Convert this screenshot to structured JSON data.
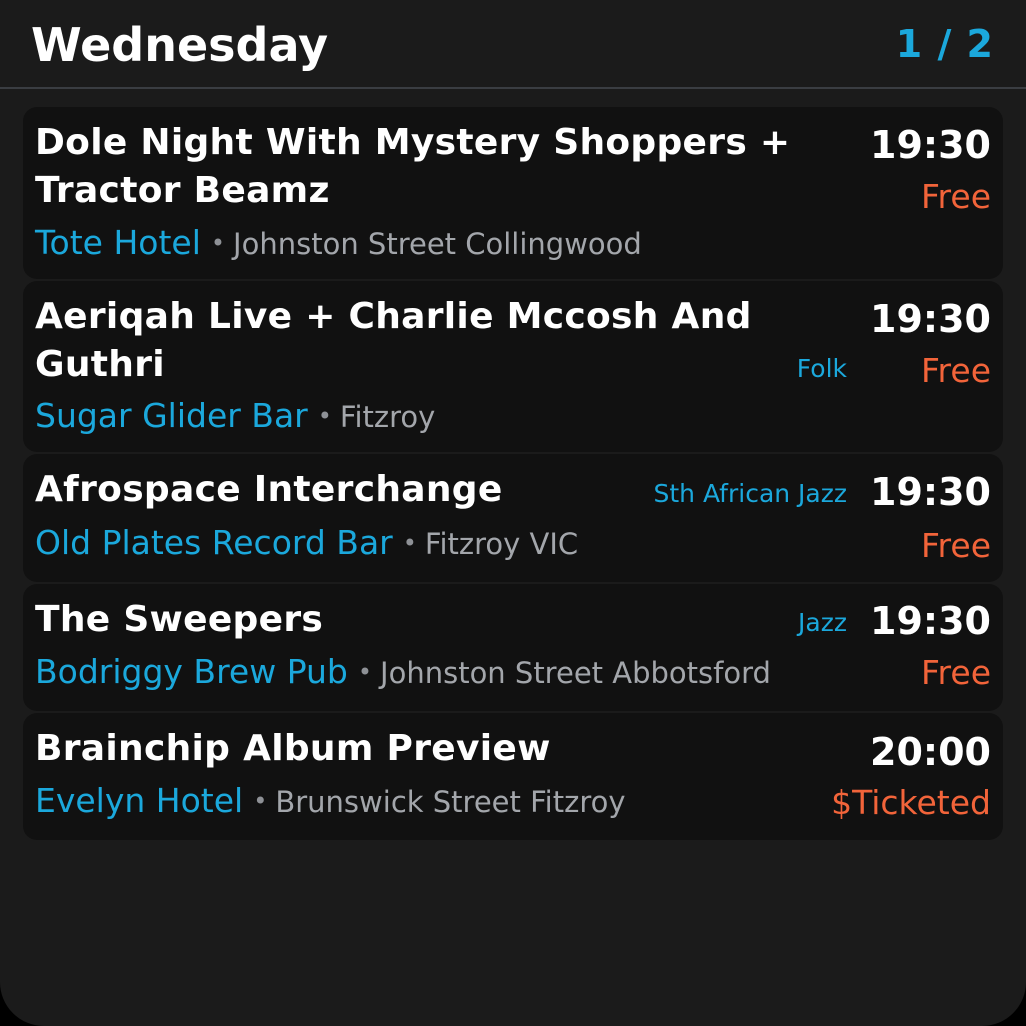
{
  "header": {
    "day": "Wednesday",
    "page_indicator": "1 / 2"
  },
  "colors": {
    "background": "#1b1b1b",
    "card": "#111111",
    "accent": "#1ba8dc",
    "price": "#f2643a",
    "title": "#ffffff",
    "muted": "#a3a6ab"
  },
  "separator": "•",
  "events": [
    {
      "title": "Dole Night With Mystery Shoppers + Tractor Beamz",
      "venue": "Tote Hotel",
      "location": "Johnston Street Collingwood",
      "genre": "",
      "time": "19:30",
      "price": "Free"
    },
    {
      "title": "Aeriqah Live + Charlie Mccosh And Guthri",
      "venue": "Sugar Glider Bar",
      "location": "Fitzroy",
      "genre": "Folk",
      "time": "19:30",
      "price": "Free"
    },
    {
      "title": "Afrospace Interchange",
      "venue": "Old Plates Record Bar",
      "location": "Fitzroy VIC",
      "genre": "Sth African Jazz",
      "time": "19:30",
      "price": "Free"
    },
    {
      "title": "The Sweepers",
      "venue": "Bodriggy Brew Pub",
      "location": "Johnston Street Abbotsford",
      "genre": "Jazz",
      "time": "19:30",
      "price": "Free"
    },
    {
      "title": "Brainchip Album Preview",
      "venue": "Evelyn Hotel",
      "location": "Brunswick Street Fitzroy",
      "genre": "",
      "time": "20:00",
      "price": "$Ticketed"
    }
  ]
}
